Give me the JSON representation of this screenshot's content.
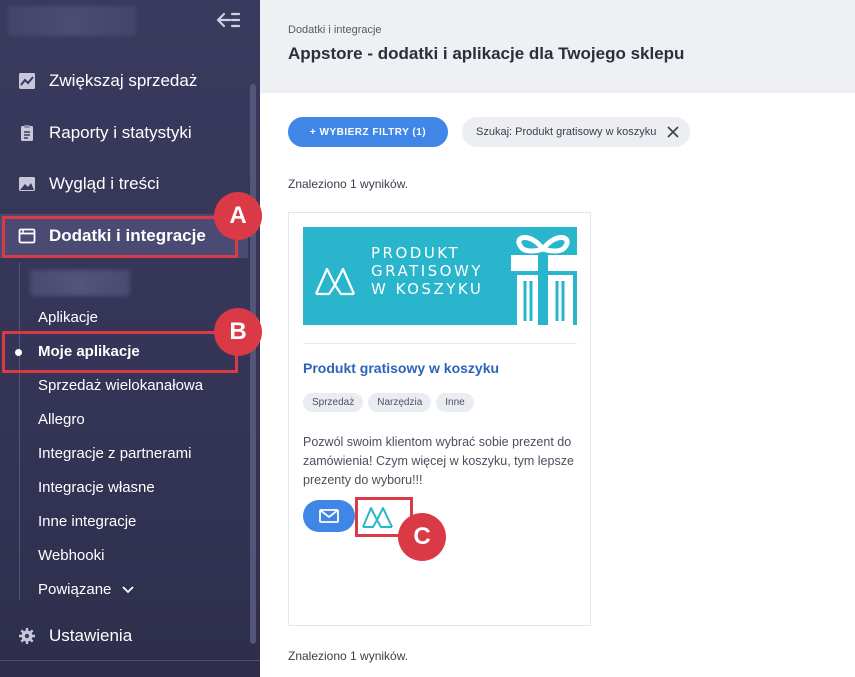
{
  "sidebar": {
    "items": [
      {
        "label": "Zwiększaj sprzedaż",
        "icon": "chart-line-icon"
      },
      {
        "label": "Raporty i statystyki",
        "icon": "clipboard-icon"
      },
      {
        "label": "Wygląd i treści",
        "icon": "image-icon"
      },
      {
        "label": "Dodatki i integracje",
        "icon": "window-icon"
      },
      {
        "label": "Ustawienia",
        "icon": "gear-icon"
      }
    ],
    "subitems": [
      "Aplikacje",
      "Moje aplikacje",
      "Sprzedaż wielokanałowa",
      "Allegro",
      "Integracje z partnerami",
      "Integracje własne",
      "Inne integracje",
      "Webhooki",
      "Powiązane"
    ]
  },
  "annotations": {
    "a": "A",
    "b": "B",
    "c": "C"
  },
  "header": {
    "breadcrumb": "Dodatki i integracje",
    "title": "Appstore - dodatki i aplikacje dla Twojego sklepu"
  },
  "filters": {
    "button_label": "+ WYBIERZ FILTRY (1)",
    "active_chip": "Szukaj: Produkt gratisowy w koszyku"
  },
  "results": {
    "count_text": "Znaleziono 1 wyników.",
    "card": {
      "banner_lines": [
        "PRODUKT",
        "GRATISOWY",
        "W KOSZYKU"
      ],
      "title": "Produkt gratisowy w koszyku",
      "tags": [
        "Sprzedaż",
        "Narzędzia",
        "Inne"
      ],
      "description": "Pozwól swoim klientom wybrać sobie prezent do zamówienia! Czym więcej w koszyku, tym lepsze prezenty do wyboru!!!"
    }
  },
  "colors": {
    "sidebar_bg": "#3a3a5e",
    "accent": "#3f86e6",
    "highlight": "#d93a45",
    "banner": "#29b5cc"
  }
}
